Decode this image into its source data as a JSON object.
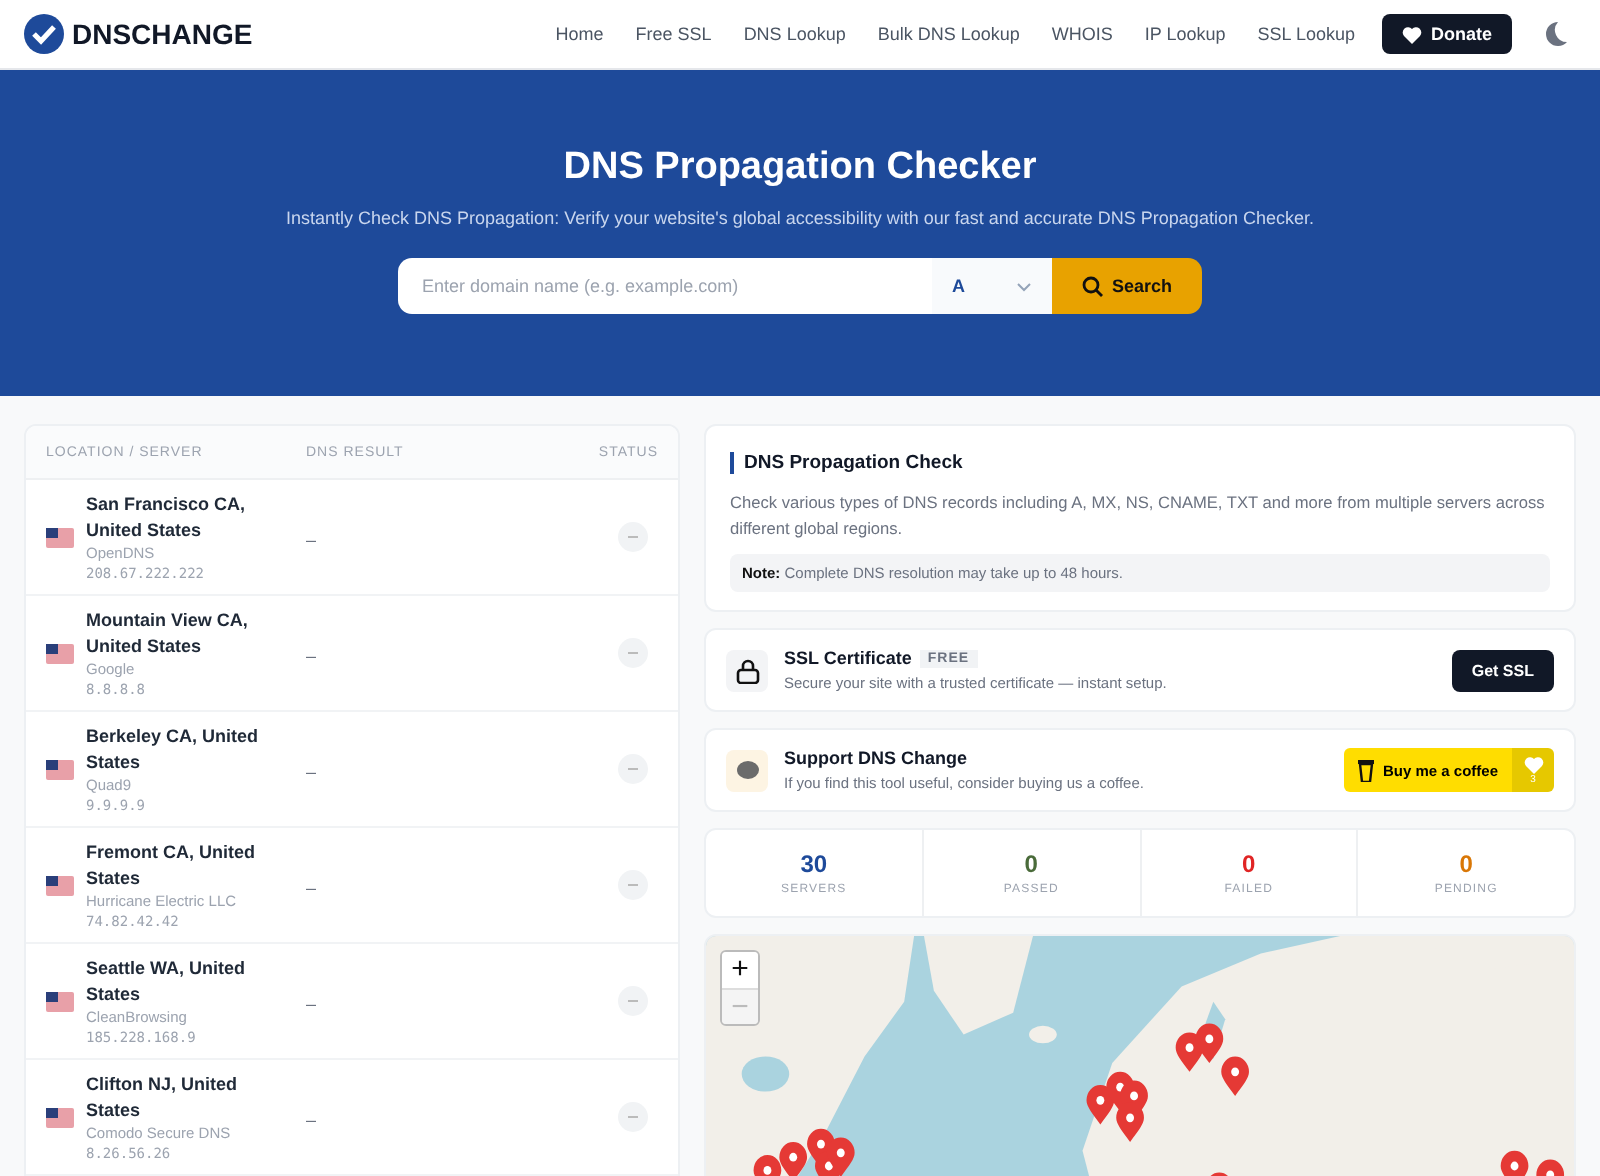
{
  "header": {
    "logo": "DNSCHANGE",
    "nav": [
      {
        "label": "Home"
      },
      {
        "label": "Free SSL"
      },
      {
        "label": "DNS Lookup"
      },
      {
        "label": "Bulk DNS Lookup"
      },
      {
        "label": "WHOIS"
      },
      {
        "label": "IP Lookup"
      },
      {
        "label": "SSL Lookup"
      }
    ],
    "donate": "Donate"
  },
  "hero": {
    "title": "DNS Propagation Checker",
    "subtitle": "Instantly Check DNS Propagation: Verify your website's global accessibility with our fast and accurate DNS Propagation Checker.",
    "placeholder": "Enter domain name (e.g. example.com)",
    "record_type": "A",
    "search": "Search"
  },
  "table": {
    "columns": [
      "LOCATION / SERVER",
      "DNS RESULT",
      "STATUS"
    ],
    "rows": [
      {
        "location": "San Francisco CA, United States",
        "provider": "OpenDNS",
        "ip": "208.67.222.222",
        "result": "–"
      },
      {
        "location": "Mountain View CA, United States",
        "provider": "Google",
        "ip": "8.8.8.8",
        "result": "–"
      },
      {
        "location": "Berkeley CA, United States",
        "provider": "Quad9",
        "ip": "9.9.9.9",
        "result": "–"
      },
      {
        "location": "Fremont CA, United States",
        "provider": "Hurricane Electric LLC",
        "ip": "74.82.42.42",
        "result": "–"
      },
      {
        "location": "Seattle WA, United States",
        "provider": "CleanBrowsing",
        "ip": "185.228.168.9",
        "result": "–"
      },
      {
        "location": "Clifton NJ, United States",
        "provider": "Comodo Secure DNS",
        "ip": "8.26.56.26",
        "result": "–"
      }
    ]
  },
  "info": {
    "title": "DNS Propagation Check",
    "text": "Check various types of DNS records including A, MX, NS, CNAME, TXT and more from multiple servers across different global regions.",
    "note": "**Note:** Complete DNS resolution may take up to 48 hours."
  },
  "ssl": {
    "title": "SSL Certificate",
    "badge": "FREE",
    "text": "Secure your site with a trusted certificate — instant setup.",
    "button": "Get SSL"
  },
  "support": {
    "title": "Support DNS Change",
    "text": "If you find this tool useful, consider buying us a coffee.",
    "button": "Buy me a coffee",
    "count": "3"
  },
  "stats": [
    {
      "value": "30",
      "label": "SERVERS",
      "color": "#1e4a9a"
    },
    {
      "value": "0",
      "label": "PASSED",
      "color": "#4a6b3a"
    },
    {
      "value": "0",
      "label": "FAILED",
      "color": "#e02424"
    },
    {
      "value": "0",
      "label": "PENDING",
      "color": "#d97706"
    }
  ],
  "map": {
    "kind": "picture",
    "zoom_in": "+",
    "zoom_out": "−",
    "zoom_out_disabled": true
  }
}
